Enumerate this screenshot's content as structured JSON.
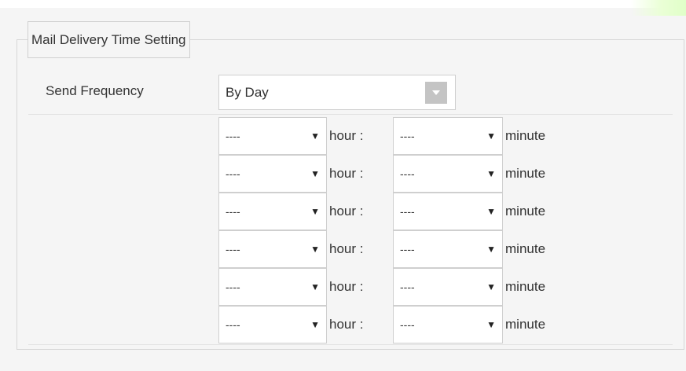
{
  "legend": "Mail Delivery Time Setting",
  "send_frequency": {
    "label": "Send Frequency",
    "value": "By Day"
  },
  "time_rows": [
    {
      "hour": "----",
      "hour_sep": "hour  :",
      "minute": "----",
      "minute_label": "minute"
    },
    {
      "hour": "----",
      "hour_sep": "hour  :",
      "minute": "----",
      "minute_label": "minute"
    },
    {
      "hour": "----",
      "hour_sep": "hour  :",
      "minute": "----",
      "minute_label": "minute"
    },
    {
      "hour": "----",
      "hour_sep": "hour  :",
      "minute": "----",
      "minute_label": "minute"
    },
    {
      "hour": "----",
      "hour_sep": "hour  :",
      "minute": "----",
      "minute_label": "minute"
    },
    {
      "hour": "----",
      "hour_sep": "hour  :",
      "minute": "----",
      "minute_label": "minute"
    }
  ],
  "icons": {
    "frequency_dropdown": "chevron-down-icon",
    "time_dropdown": "caret-down-icon"
  }
}
